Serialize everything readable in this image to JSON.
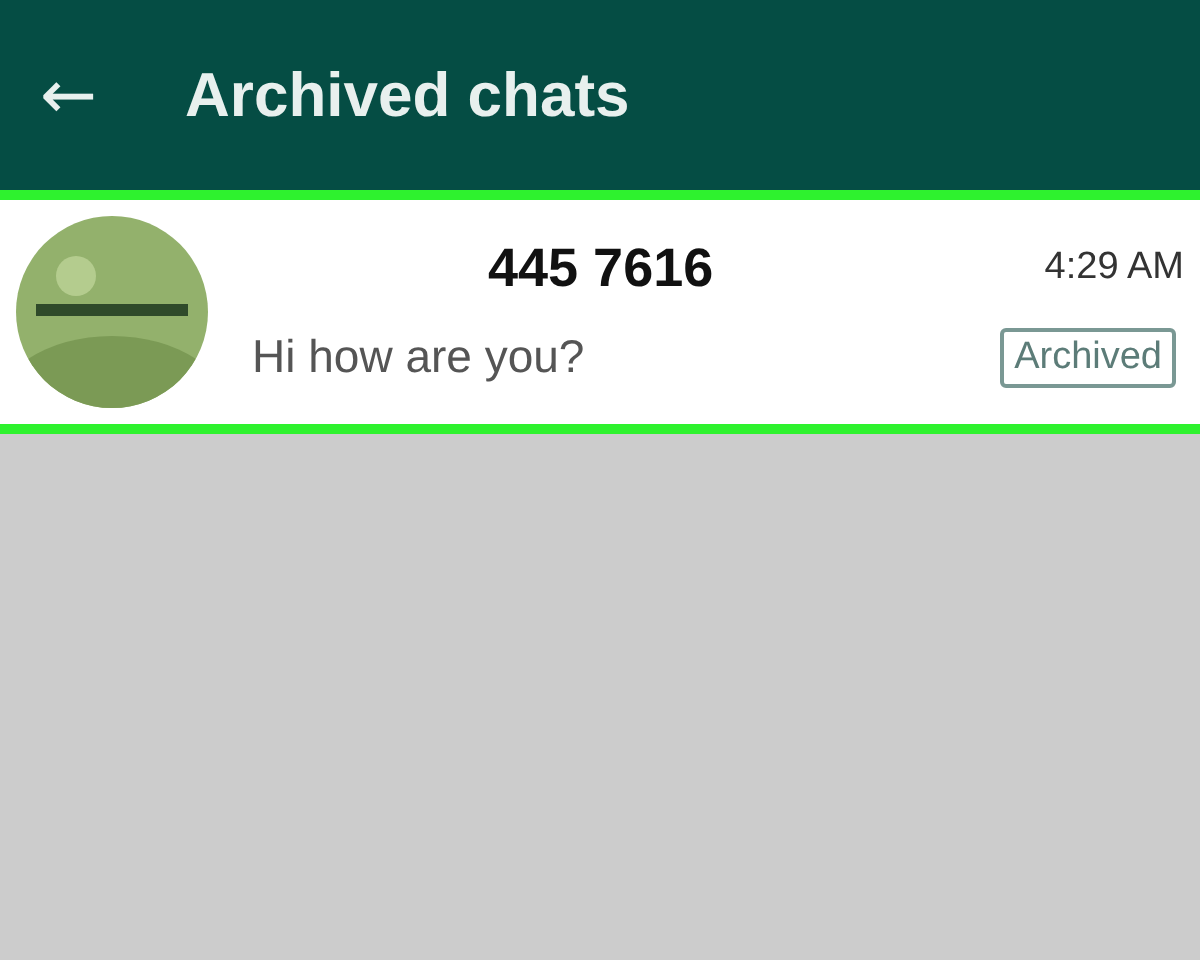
{
  "header": {
    "back": "←",
    "title": "Archived chats"
  },
  "chats": [
    {
      "name": "445 7616",
      "time": "4:29 AM",
      "message": "Hi how are you?",
      "badge": "Archived",
      "highlighted": true
    }
  ]
}
